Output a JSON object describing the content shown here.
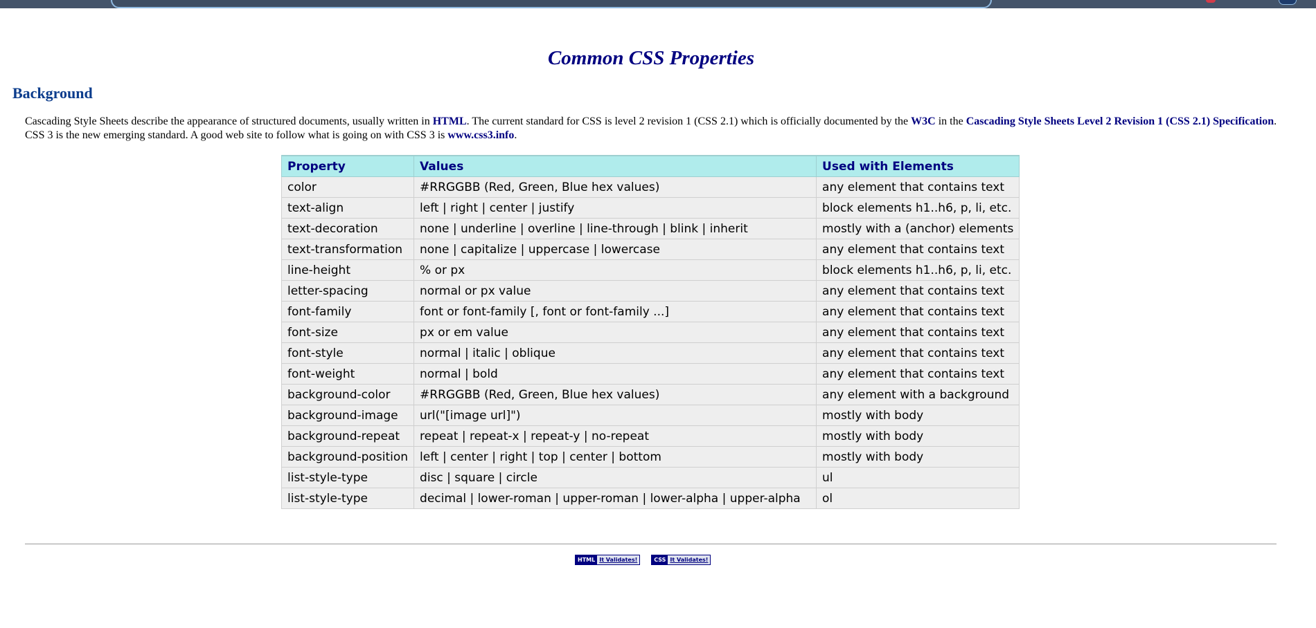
{
  "page": {
    "title": "Common CSS Properties",
    "section_heading": "Background"
  },
  "intro": {
    "text_1": "Cascading Style Sheets describe the appearance of structured documents, usually written in ",
    "link_html": "HTML",
    "text_2": ". The current standard for CSS is level 2 revision 1 (CSS 2.1) which is officially documented by the ",
    "link_w3c": "W3C",
    "text_3": " in the ",
    "link_spec": "Cascading Style Sheets Level 2 Revision 1 (CSS 2.1) Specification",
    "text_4": ". CSS 3 is the new emerging standard. A good web site to follow what is going on with CSS 3 is ",
    "link_css3": "www.css3.info",
    "text_5": "."
  },
  "table": {
    "headers": [
      "Property",
      "Values",
      "Used with Elements"
    ],
    "rows": [
      [
        "color",
        "#RRGGBB (Red, Green, Blue hex values)",
        "any element that contains text"
      ],
      [
        "text-align",
        "left | right | center | justify",
        "block elements h1..h6, p, li, etc."
      ],
      [
        "text-decoration",
        "none | underline | overline | line-through | blink | inherit",
        "mostly with a (anchor) elements"
      ],
      [
        "text-transformation",
        "none | capitalize | uppercase | lowercase",
        "any element that contains text"
      ],
      [
        "line-height",
        "% or px",
        "block elements h1..h6, p, li, etc."
      ],
      [
        "letter-spacing",
        "normal or px value",
        "any element that contains text"
      ],
      [
        "font-family",
        "font or font-family [, font or font-family ...]",
        "any element that contains text"
      ],
      [
        "font-size",
        "px or em value",
        "any element that contains text"
      ],
      [
        "font-style",
        "normal | italic | oblique",
        "any element that contains text"
      ],
      [
        "font-weight",
        "normal | bold",
        "any element that contains text"
      ],
      [
        "background-color",
        "#RRGGBB (Red, Green, Blue hex values)",
        "any element with a background"
      ],
      [
        "background-image",
        "url(\"[image url]\")",
        "mostly with body"
      ],
      [
        "background-repeat",
        "repeat | repeat-x | repeat-y | no-repeat",
        "mostly with body"
      ],
      [
        "background-position",
        "left | center | right | top | center | bottom",
        "mostly with body"
      ],
      [
        "list-style-type",
        "disc | square | circle",
        "ul"
      ],
      [
        "list-style-type",
        "decimal | lower-roman | upper-roman | lower-alpha | upper-alpha",
        "ol"
      ]
    ]
  },
  "footer": {
    "html_badge": {
      "tag": "HTML",
      "label": "It Validates!"
    },
    "css_badge": {
      "tag": "CSS",
      "label": "It Validates!"
    }
  },
  "colors": {
    "title": "#000080",
    "heading": "#0b3c8c",
    "table_header_bg": "#b0ecec",
    "table_cell_bg": "#eeeeee",
    "browser_bar": "#44546a"
  }
}
